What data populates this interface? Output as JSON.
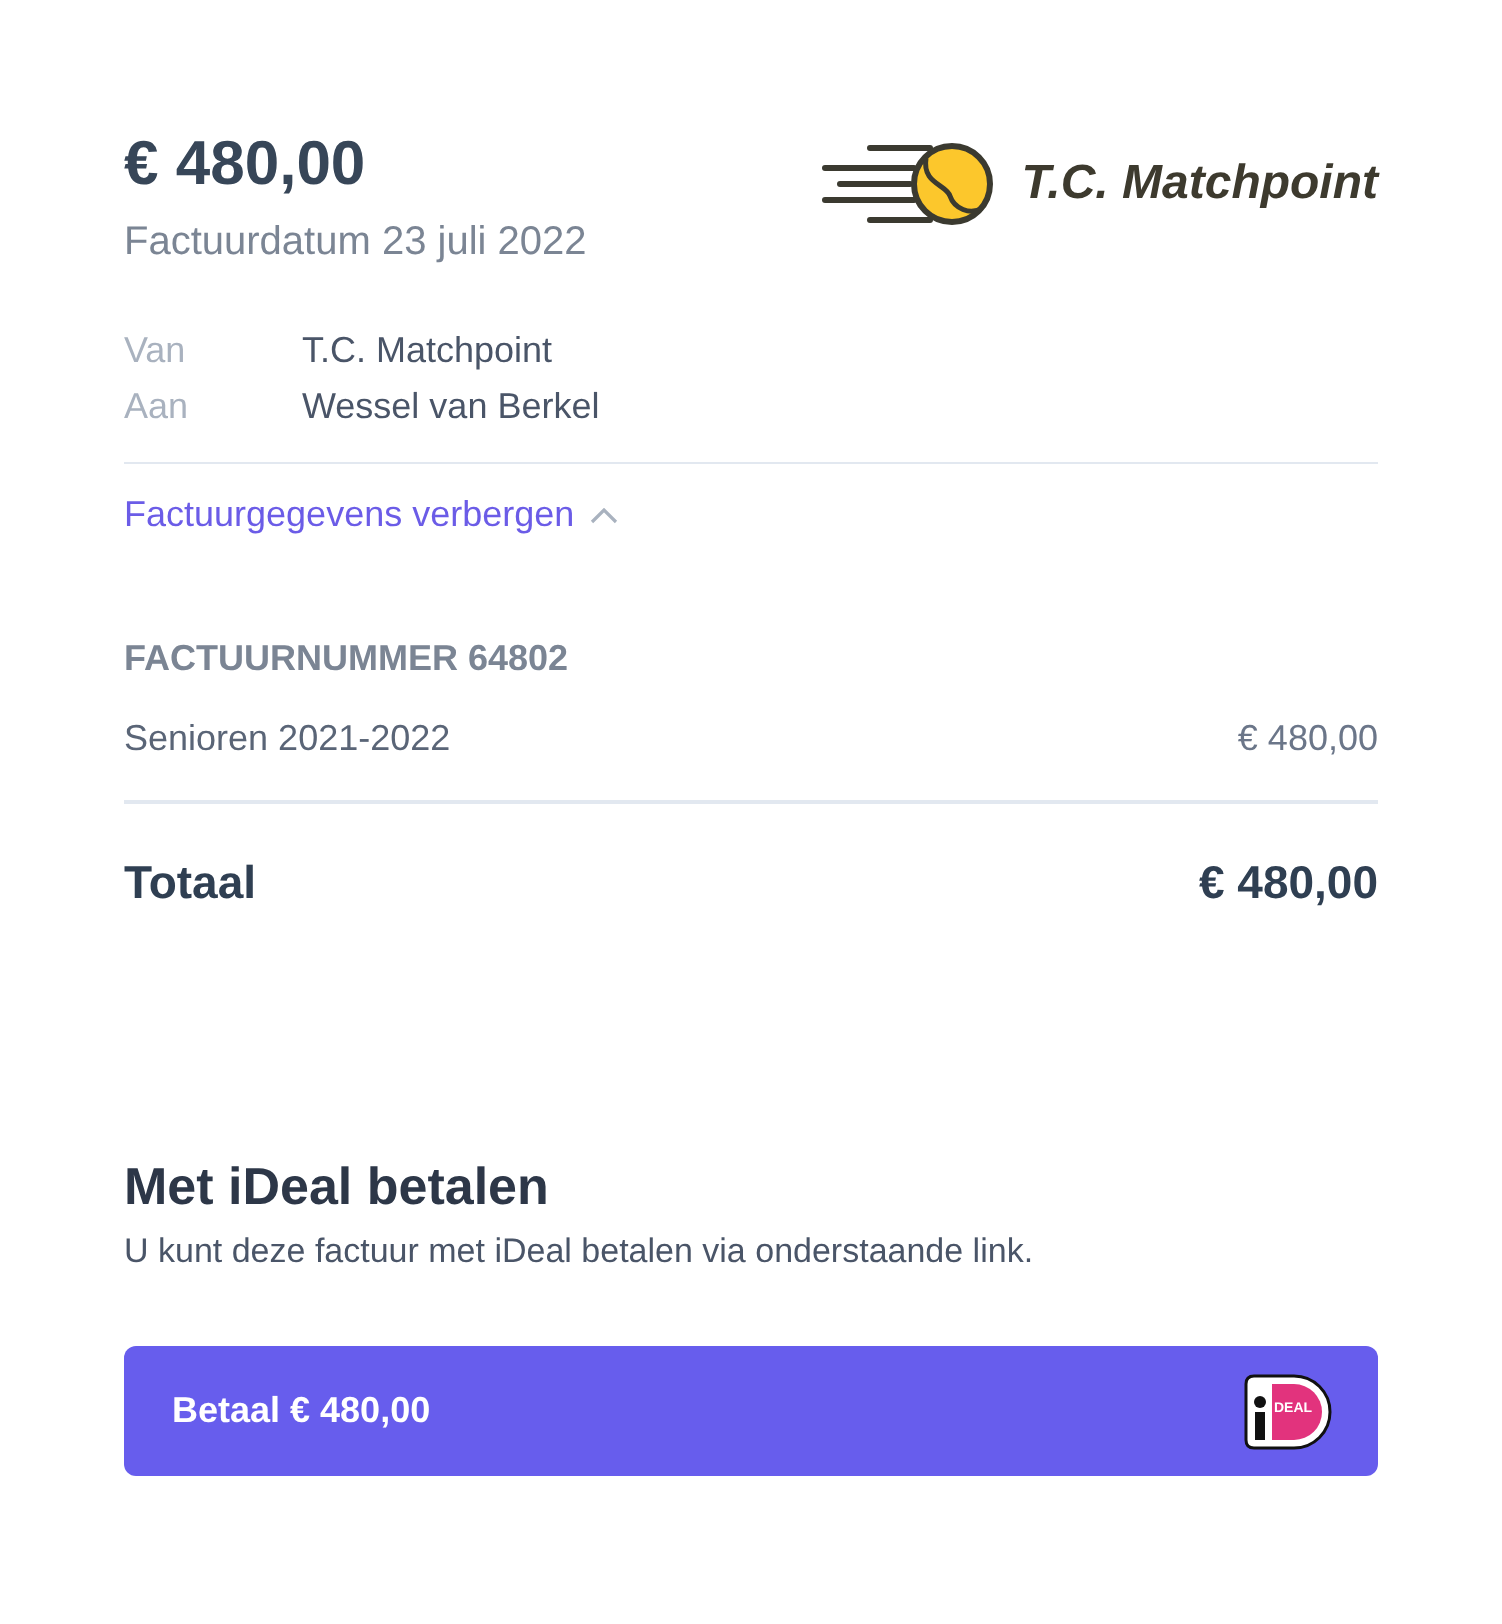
{
  "invoice": {
    "amount": "€ 480,00",
    "date_line": "Factuurdatum 23 juli 2022"
  },
  "logo": {
    "name": "T.C. Matchpoint"
  },
  "parties": [
    {
      "label": "Van",
      "value": "T.C. Matchpoint"
    },
    {
      "label": "Aan",
      "value": "Wessel van Berkel"
    }
  ],
  "details_toggle": {
    "label": "Factuurgegevens verbergen",
    "expanded": true
  },
  "invoice_number": "FACTUURNUMMER 64802",
  "line_items": [
    {
      "description": "Senioren 2021-2022",
      "amount": "€ 480,00"
    }
  ],
  "total": {
    "label": "Totaal",
    "amount": "€ 480,00"
  },
  "payment": {
    "title": "Met iDeal betalen",
    "description": "U kunt deze factuur met iDeal betalen via onderstaande link.",
    "button": {
      "label": "Betaal € 480,00",
      "logo_text": "DEAL"
    }
  }
}
